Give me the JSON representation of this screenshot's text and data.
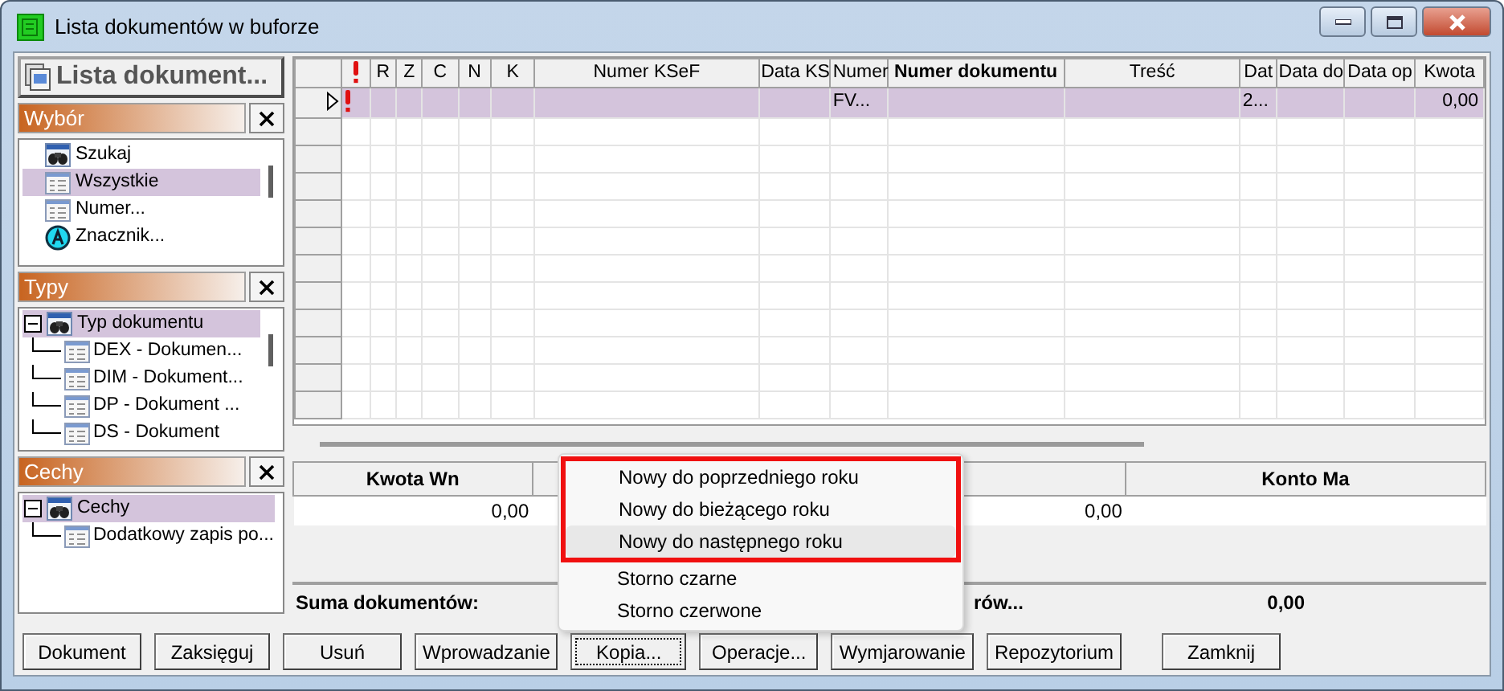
{
  "window": {
    "title": "Lista dokumentów w buforze"
  },
  "sidebar": {
    "title": "Lista dokument...",
    "panels": [
      {
        "title": "Wybór",
        "items": [
          {
            "kind": "search",
            "label": "Szukaj",
            "selected": false
          },
          {
            "kind": "list",
            "label": "Wszystkie",
            "selected": true
          },
          {
            "kind": "list",
            "label": "Numer...",
            "selected": false
          },
          {
            "kind": "tag",
            "label": "Znacznik...",
            "selected": false
          }
        ]
      },
      {
        "title": "Typy",
        "items": [
          {
            "kind": "search",
            "label": "Typ dokumentu",
            "selected": true,
            "expanded": true,
            "children": [
              {
                "kind": "list",
                "label": "DEX - Dokumen...",
                "selected": false
              },
              {
                "kind": "list",
                "label": "DIM - Dokument...",
                "selected": false
              },
              {
                "kind": "list",
                "label": "DP - Dokument ...",
                "selected": false
              },
              {
                "kind": "list",
                "label": "DS - Dokument",
                "selected": false
              }
            ]
          }
        ]
      },
      {
        "title": "Cechy",
        "items": [
          {
            "kind": "search",
            "label": "Cechy",
            "selected": true,
            "expanded": true,
            "children": [
              {
                "kind": "list",
                "label": "Dodatkowy zapis po...",
                "selected": false
              }
            ]
          }
        ]
      }
    ]
  },
  "table": {
    "columns": [
      {
        "kind": "flag"
      },
      {
        "kind": "text",
        "label": "R",
        "sorted": false
      },
      {
        "kind": "text",
        "label": "Z",
        "sorted": false
      },
      {
        "kind": "text",
        "label": "C",
        "sorted": false
      },
      {
        "kind": "text",
        "label": "N",
        "sorted": false
      },
      {
        "kind": "text",
        "label": "K",
        "sorted": false
      },
      {
        "kind": "text",
        "label": "Numer KSeF",
        "sorted": false
      },
      {
        "kind": "text",
        "label": "Data KS",
        "sorted": false
      },
      {
        "kind": "text",
        "label": "Numer",
        "sorted": false
      },
      {
        "kind": "text",
        "label": "Numer dokumentu",
        "sorted": true
      },
      {
        "kind": "text",
        "label": "Treść",
        "sorted": false
      },
      {
        "kind": "text",
        "label": "Dat",
        "sorted": false
      },
      {
        "kind": "text",
        "label": "Data do",
        "sorted": false
      },
      {
        "kind": "text",
        "label": "Data op",
        "sorted": false
      },
      {
        "kind": "text",
        "label": "Kwota",
        "sorted": false
      }
    ],
    "rows": [
      {
        "selected": true,
        "current": true,
        "flag": true,
        "values": {
          "8": "FV...",
          "11": "2...",
          "14": "0,00"
        }
      }
    ]
  },
  "entry_table": {
    "columns": [
      {
        "label": "Kwota Wn",
        "value": "0,00"
      },
      {
        "value": "0,00"
      },
      {
        "label": "Konto Ma"
      }
    ]
  },
  "summary": {
    "label": "Suma dokumentów:",
    "partial_label": "rów...",
    "total": "0,00"
  },
  "buttons": [
    {
      "label": "Dokument",
      "focused": false
    },
    {
      "label": "Zaksięguj",
      "focused": false
    },
    {
      "label": "Usuń",
      "focused": false
    },
    {
      "label": "Wprowadzanie",
      "focused": false
    },
    {
      "label": "Kopia...",
      "focused": true
    },
    {
      "label": "Operacje...",
      "focused": false
    },
    {
      "label": "Wymjarowanie",
      "focused": false
    },
    {
      "label": "Repozytorium",
      "focused": false
    },
    {
      "label": "Zamknij",
      "focused": false
    }
  ],
  "context_menu": {
    "items": [
      {
        "label": "Nowy do poprzedniego roku",
        "highlighted": true,
        "hovered": false
      },
      {
        "label": "Nowy do bieżącego roku",
        "highlighted": true,
        "hovered": false
      },
      {
        "label": "Nowy do następnego roku",
        "highlighted": true,
        "hovered": true
      },
      {
        "label": "Storno czarne",
        "highlighted": false,
        "hovered": false
      },
      {
        "label": "Storno czerwone",
        "highlighted": false,
        "hovered": false
      }
    ]
  }
}
